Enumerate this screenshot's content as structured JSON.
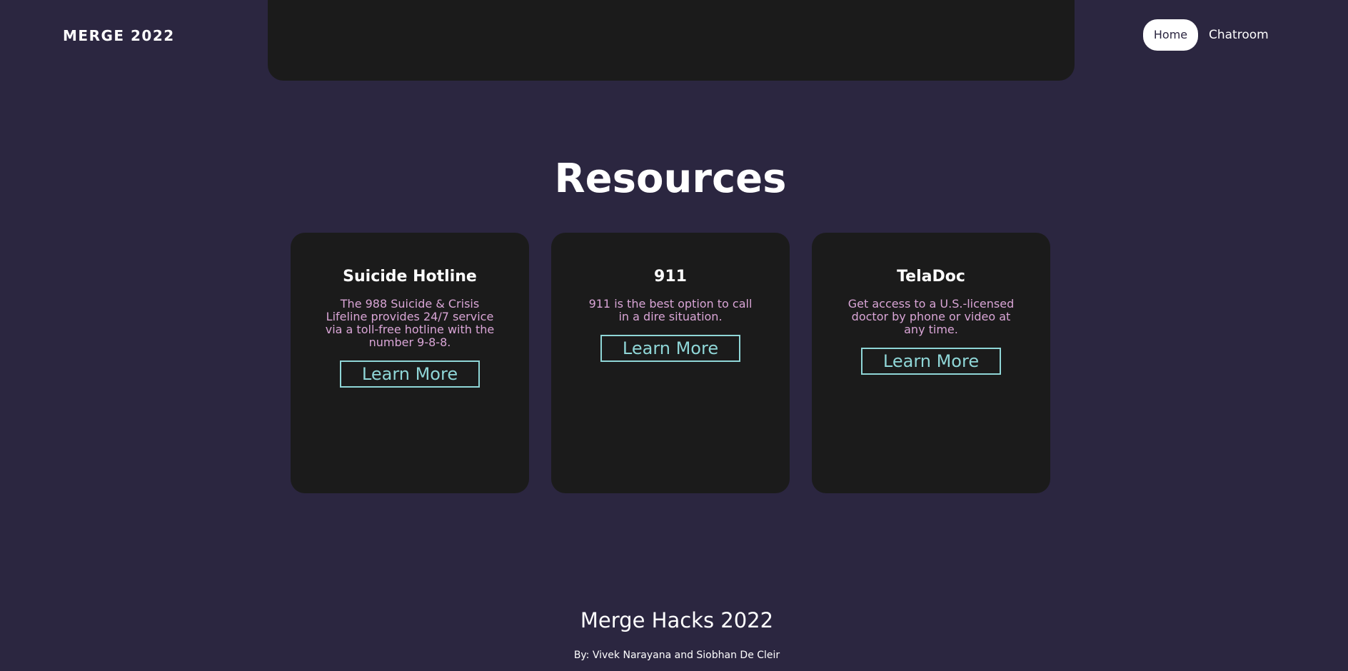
{
  "header": {
    "brand": "MERGE 2022",
    "nav": {
      "home": "Home",
      "chatroom": "Chatroom"
    }
  },
  "resources": {
    "title": "Resources",
    "cards": [
      {
        "title": "Suicide Hotline",
        "description": "The 988 Suicide & Crisis Lifeline provides 24/7 service via a toll-free hotline with the number 9-8-8.",
        "button": "Learn More"
      },
      {
        "title": "911",
        "description": "911 is the best option to call in a dire situation.",
        "button": "Learn More"
      },
      {
        "title": "TelaDoc",
        "description": "Get access to a U.S.-licensed doctor by phone or video at any time.",
        "button": "Learn More"
      }
    ]
  },
  "footer": {
    "title": "Merge Hacks 2022",
    "credit": "By: Vivek Narayana and Siobhan De Cleir"
  },
  "colors": {
    "background": "#2b2640",
    "card": "#1b1b1b",
    "accent": "#8fd6d7",
    "description": "#d9a5d6"
  }
}
